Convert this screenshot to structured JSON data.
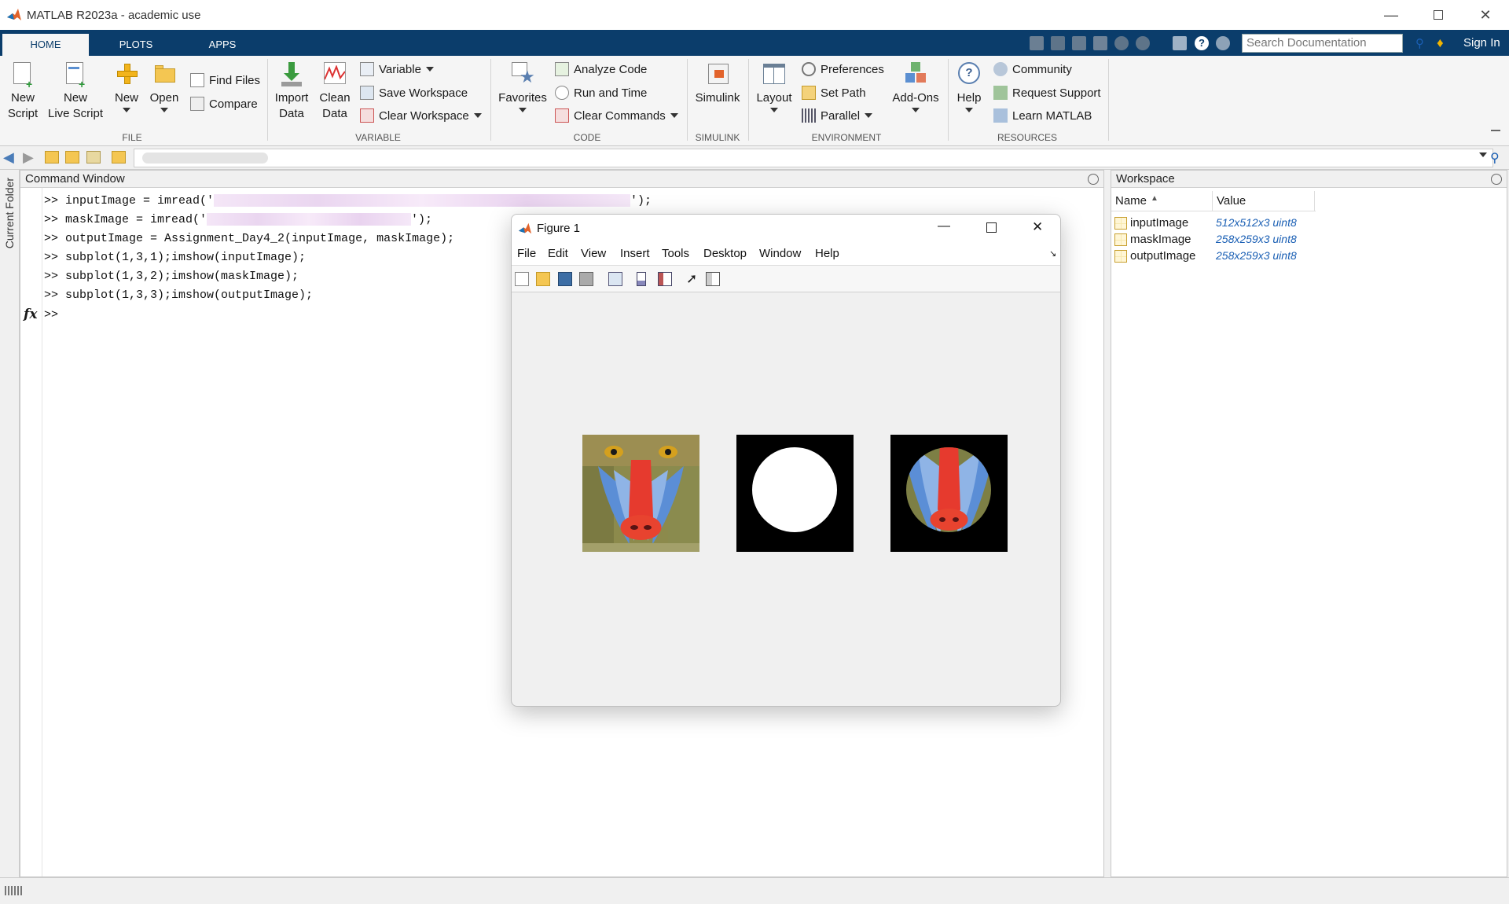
{
  "window": {
    "title": "MATLAB R2023a - academic use"
  },
  "tabs": [
    {
      "label": "HOME"
    },
    {
      "label": "PLOTS"
    },
    {
      "label": "APPS"
    }
  ],
  "search": {
    "placeholder": "Search Documentation"
  },
  "account": {
    "sign_in": "Sign In"
  },
  "ribbon": {
    "file": {
      "label": "FILE",
      "new_script": [
        "New",
        "Script"
      ],
      "new_live_script": [
        "New",
        "Live Script"
      ],
      "new": "New",
      "open": "Open",
      "find_files": "Find Files",
      "compare": "Compare"
    },
    "variable": {
      "label": "VARIABLE",
      "import_data": [
        "Import",
        "Data"
      ],
      "clean_data": [
        "Clean",
        "Data"
      ],
      "variable": "Variable",
      "save_workspace": "Save Workspace",
      "clear_workspace": "Clear Workspace"
    },
    "code": {
      "label": "CODE",
      "favorites": "Favorites",
      "analyze_code": "Analyze Code",
      "run_and_time": "Run and Time",
      "clear_commands": "Clear Commands"
    },
    "simulink": {
      "label": "SIMULINK",
      "simulink": "Simulink"
    },
    "environment": {
      "label": "ENVIRONMENT",
      "layout": "Layout",
      "preferences": "Preferences",
      "set_path": "Set Path",
      "parallel": "Parallel",
      "add_ons": "Add-Ons"
    },
    "resources": {
      "label": "RESOURCES",
      "help": "Help",
      "community": "Community",
      "request_support": "Request Support",
      "learn_matlab": "Learn MATLAB"
    }
  },
  "side": {
    "current_folder": "Current Folder"
  },
  "command_window": {
    "title": "Command Window",
    "lines": [
      {
        "pre": ">> inputImage = imread('",
        "post": "');"
      },
      {
        "pre": ">> maskImage = imread('",
        "post": "');"
      },
      {
        "pre": ">> outputImage = Assignment_Day4_2(inputImage, maskImage);",
        "post": ""
      },
      {
        "pre": ">> subplot(1,3,1);imshow(inputImage);",
        "post": ""
      },
      {
        "pre": ">> subplot(1,3,2);imshow(maskImage);",
        "post": ""
      },
      {
        "pre": ">> subplot(1,3,3);imshow(outputImage);",
        "post": ""
      }
    ],
    "prompt": ">>",
    "fx": "fx"
  },
  "workspace": {
    "title": "Workspace",
    "columns": {
      "name": "Name",
      "value": "Value"
    },
    "rows": [
      {
        "name": "inputImage",
        "value": "512x512x3 uint8"
      },
      {
        "name": "maskImage",
        "value": "258x259x3 uint8"
      },
      {
        "name": "outputImage",
        "value": "258x259x3 uint8"
      }
    ]
  },
  "figure": {
    "title": "Figure 1",
    "menu": [
      "File",
      "Edit",
      "View",
      "Insert",
      "Tools",
      "Desktop",
      "Window",
      "Help"
    ]
  },
  "colors": {
    "tab_strip": "#0b3d6b",
    "accent_link": "#1a5fb4",
    "matlab_orange": "#e2632b"
  }
}
